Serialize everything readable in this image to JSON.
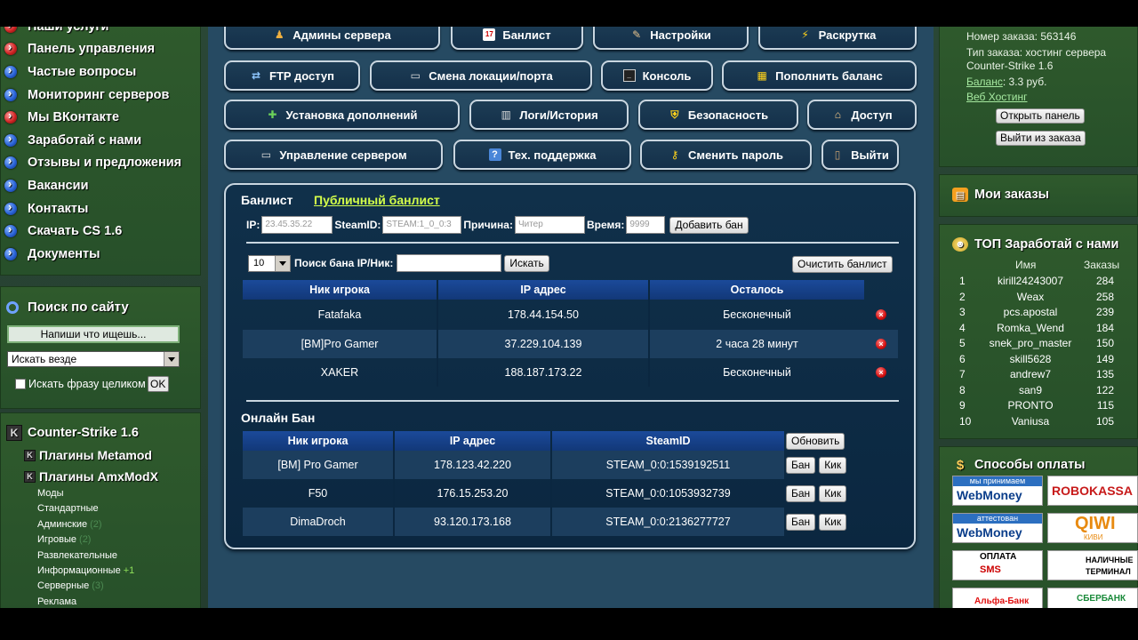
{
  "left_menu": {
    "items": [
      {
        "label": "Наши услуги",
        "dot": "red"
      },
      {
        "label": "Панель управления",
        "dot": "red"
      },
      {
        "label": "Частые вопросы",
        "dot": "blue"
      },
      {
        "label": "Мониторинг серверов",
        "dot": "blue"
      },
      {
        "label": "Мы ВКонтакте",
        "dot": "red"
      },
      {
        "label": "Заработай с нами",
        "dot": "blue"
      },
      {
        "label": "Отзывы и предложения",
        "dot": "blue"
      },
      {
        "label": "Вакансии",
        "dot": "blue"
      },
      {
        "label": "Контакты",
        "dot": "blue"
      },
      {
        "label": "Скачать CS 1.6",
        "dot": "blue"
      },
      {
        "label": "Документы",
        "dot": "blue"
      }
    ]
  },
  "site_search": {
    "title": "Поиск по сайту",
    "input_value": "Напиши что ищешь...",
    "scope_value": "Искать везде",
    "phrase_label": "Искать фразу целиком",
    "ok_label": "OK"
  },
  "games": {
    "title": "Counter-Strike 1.6",
    "metamod_label": "Плагины Metamod",
    "amx_label": "Плагины AmxModX",
    "plugins": [
      {
        "label": "Моды",
        "count": ""
      },
      {
        "label": "Стандартные",
        "count": ""
      },
      {
        "label": "Админские",
        "count": "(2)"
      },
      {
        "label": "Игровые",
        "count": "(2)"
      },
      {
        "label": "Развлекательные",
        "count": ""
      },
      {
        "label": "Информационные",
        "count": "+1"
      },
      {
        "label": "Серверные",
        "count": "(3)"
      },
      {
        "label": "Реклама",
        "count": ""
      }
    ]
  },
  "nav_buttons": {
    "admins": "Админы сервера",
    "banlist": "Банлист",
    "settings": "Настройки",
    "promo": "Раскрутка",
    "ftp": "FTP доступ",
    "location": "Смена локации/порта",
    "console": "Консоль",
    "topup": "Пополнить баланс",
    "addons": "Установка дополнений",
    "logs": "Логи/История",
    "security": "Безопасность",
    "access": "Доступ",
    "server_mgmt": "Управление сервером",
    "support": "Тех. поддержка",
    "change_pass": "Сменить пароль",
    "logout": "Выйти"
  },
  "banlist": {
    "title": "Банлист",
    "public_link": "Публичный банлист",
    "form": {
      "ip_label": "IP:",
      "ip_value": "23.45.35.22",
      "steam_label": "SteamID:",
      "steam_value": "STEAM:1_0_0:3",
      "reason_label": "Причина:",
      "reason_value": "Читер",
      "time_label": "Время:",
      "time_value": "9999",
      "add_button": "Добавить бан"
    },
    "search": {
      "per_page": "10",
      "label": "Поиск бана IP/Ник:",
      "value": "",
      "search_button": "Искать",
      "clear_button": "Очистить банлист"
    },
    "columns": [
      "Ник игрока",
      "IP адрес",
      "Осталось"
    ],
    "rows": [
      {
        "nick": "Fatafaka",
        "ip": "178.44.154.50",
        "left": "Бесконечный"
      },
      {
        "nick": "[BM]Pro Gamer",
        "ip": "37.229.104.139",
        "left": "2 часа 28 минут"
      },
      {
        "nick": "XAKER",
        "ip": "188.187.173.22",
        "left": "Бесконечный"
      }
    ]
  },
  "online_ban": {
    "title": "Онлайн Бан",
    "columns": [
      "Ник игрока",
      "IP адрес",
      "SteamID"
    ],
    "refresh_button": "Обновить",
    "ban_button": "Бан",
    "kick_button": "Кик",
    "rows": [
      {
        "nick": "[BM] Pro Gamer",
        "ip": "178.123.42.220",
        "steam": "STEAM_0:0:1539192511"
      },
      {
        "nick": "F50",
        "ip": "176.15.253.20",
        "steam": "STEAM_0:0:1053932739"
      },
      {
        "nick": "DimaDroch",
        "ip": "93.120.173.168",
        "steam": "STEAM_0:0:2136277727"
      }
    ]
  },
  "order": {
    "number": "Номер заказа: 563146",
    "type": "Тип заказа: хостинг сервера",
    "game": "Counter-Strike 1.6",
    "balance_link": "Баланс",
    "balance_value": ": 3.3 руб.",
    "web_hosting": "Веб Хостинг",
    "open_panel": "Открыть панель",
    "exit_order": "Выйти из заказа"
  },
  "my_orders": {
    "title": "Мои заказы"
  },
  "top_earn": {
    "title": "ТОП Заработай с нами",
    "col_name": "Имя",
    "col_orders": "Заказы",
    "rows": [
      {
        "rank": "1",
        "name": "kirill24243007",
        "orders": "284"
      },
      {
        "rank": "2",
        "name": "Weax",
        "orders": "258"
      },
      {
        "rank": "3",
        "name": "pcs.apostal",
        "orders": "239"
      },
      {
        "rank": "4",
        "name": "Romka_Wend",
        "orders": "184"
      },
      {
        "rank": "5",
        "name": "snek_pro_master",
        "orders": "150"
      },
      {
        "rank": "6",
        "name": "skill5628",
        "orders": "149"
      },
      {
        "rank": "7",
        "name": "andrew7",
        "orders": "135"
      },
      {
        "rank": "8",
        "name": "san9",
        "orders": "122"
      },
      {
        "rank": "9",
        "name": "PRONTO",
        "orders": "115"
      },
      {
        "rank": "10",
        "name": "Vaniusa",
        "orders": "105"
      }
    ]
  },
  "payment": {
    "title": "Способы оплаты",
    "logos": {
      "webmoney1_band": "мы принимаем",
      "webmoney1": "WebMoney",
      "robokassa": "ROBOKASSA",
      "webmoney2_band": "аттестован",
      "webmoney2": "WebMoney",
      "qiwi": "QIWI",
      "qiwi_sub": "КИВИ",
      "sms_band": "ОПЛАТА",
      "sms": "SMS",
      "terminal1": "НАЛИЧНЫЕ",
      "terminal2": "ТЕРМИНАЛ",
      "alfa": "Альфа-Банк",
      "sber": "СБЕРБАНК"
    }
  },
  "colors": {
    "green_panel": "#2f5a2c",
    "center_bg": "#264a62",
    "link_yellow": "#d4ff4a",
    "table_header": "#1b4a9a"
  }
}
